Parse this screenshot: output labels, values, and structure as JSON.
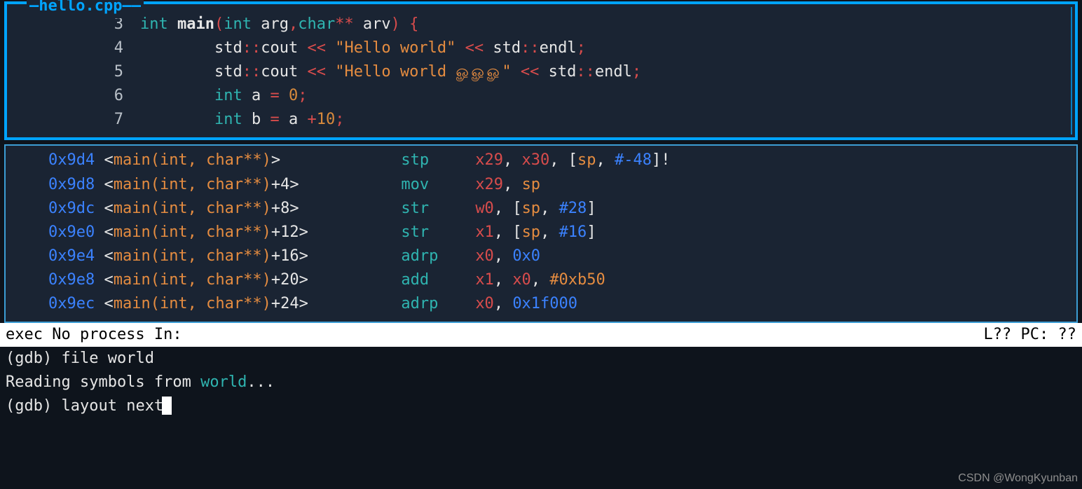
{
  "source": {
    "title_prefix": "—",
    "title": "hello.cpp",
    "title_suffix": "——",
    "lines": [
      {
        "n": "3",
        "ind": "",
        "tokens": [
          [
            "kw",
            "int "
          ],
          [
            "fn",
            "main"
          ],
          [
            "pr",
            "("
          ],
          [
            "kw",
            "int"
          ],
          [
            "id",
            " arg"
          ],
          [
            "pr",
            ","
          ],
          [
            "kw",
            "char"
          ],
          [
            "pr",
            "**"
          ],
          [
            "id",
            " arv"
          ],
          [
            "pr",
            ")"
          ],
          [
            "id",
            " "
          ],
          [
            "pr",
            "{"
          ]
        ]
      },
      {
        "n": "4",
        "ind": "        ",
        "tokens": [
          [
            "ns",
            "std"
          ],
          [
            "pr",
            "::"
          ],
          [
            "id",
            "cout"
          ],
          [
            "id",
            " "
          ],
          [
            "op",
            "<<"
          ],
          [
            "id",
            " "
          ],
          [
            "str",
            "\"Hello world\""
          ],
          [
            "id",
            " "
          ],
          [
            "op",
            "<<"
          ],
          [
            "id",
            " "
          ],
          [
            "ns",
            "std"
          ],
          [
            "pr",
            "::"
          ],
          [
            "id",
            "endl"
          ],
          [
            "pr",
            ";"
          ]
        ]
      },
      {
        "n": "5",
        "ind": "        ",
        "tokens": [
          [
            "ns",
            "std"
          ],
          [
            "pr",
            "::"
          ],
          [
            "id",
            "cout"
          ],
          [
            "id",
            " "
          ],
          [
            "op",
            "<<"
          ],
          [
            "id",
            " "
          ],
          [
            "str",
            "\"Hello world ௐௐௐ\""
          ],
          [
            "id",
            " "
          ],
          [
            "op",
            "<<"
          ],
          [
            "id",
            " "
          ],
          [
            "ns",
            "std"
          ],
          [
            "pr",
            "::"
          ],
          [
            "id",
            "endl"
          ],
          [
            "pr",
            ";"
          ]
        ]
      },
      {
        "n": "6",
        "ind": "        ",
        "tokens": [
          [
            "kw",
            "int"
          ],
          [
            "id",
            " a "
          ],
          [
            "pr",
            "="
          ],
          [
            "id",
            " "
          ],
          [
            "num",
            "0"
          ],
          [
            "pr",
            ";"
          ]
        ]
      },
      {
        "n": "7",
        "ind": "        ",
        "tokens": [
          [
            "kw",
            "int"
          ],
          [
            "id",
            " b "
          ],
          [
            "pr",
            "="
          ],
          [
            "id",
            " a "
          ],
          [
            "pr",
            "+"
          ],
          [
            "num",
            "10"
          ],
          [
            "pr",
            ";"
          ]
        ]
      }
    ]
  },
  "asm": {
    "rows": [
      {
        "addr": "0x9d4",
        "sym": "main(int, char**)",
        "off": "",
        "mn": "stp",
        "ops": [
          [
            "reg-red",
            "x29"
          ],
          [
            "comma",
            ", "
          ],
          [
            "reg-red",
            "x30"
          ],
          [
            "comma",
            ", "
          ],
          [
            "bracket",
            "["
          ],
          [
            "reg-orange",
            "sp"
          ],
          [
            "comma",
            ", "
          ],
          [
            "imm-blue",
            "#-48"
          ],
          [
            "bracket",
            "]"
          ],
          [
            "bracket",
            "!"
          ]
        ]
      },
      {
        "addr": "0x9d8",
        "sym": "main(int, char**)",
        "off": "+4",
        "mn": "mov",
        "ops": [
          [
            "reg-red",
            "x29"
          ],
          [
            "comma",
            ", "
          ],
          [
            "reg-orange",
            "sp"
          ]
        ]
      },
      {
        "addr": "0x9dc",
        "sym": "main(int, char**)",
        "off": "+8",
        "mn": "str",
        "ops": [
          [
            "reg-red",
            "w0"
          ],
          [
            "comma",
            ", "
          ],
          [
            "bracket",
            "["
          ],
          [
            "reg-orange",
            "sp"
          ],
          [
            "comma",
            ", "
          ],
          [
            "imm-blue",
            "#28"
          ],
          [
            "bracket",
            "]"
          ]
        ]
      },
      {
        "addr": "0x9e0",
        "sym": "main(int, char**)",
        "off": "+12",
        "mn": "str",
        "ops": [
          [
            "reg-red",
            "x1"
          ],
          [
            "comma",
            ", "
          ],
          [
            "bracket",
            "["
          ],
          [
            "reg-orange",
            "sp"
          ],
          [
            "comma",
            ", "
          ],
          [
            "imm-blue",
            "#16"
          ],
          [
            "bracket",
            "]"
          ]
        ]
      },
      {
        "addr": "0x9e4",
        "sym": "main(int, char**)",
        "off": "+16",
        "mn": "adrp",
        "ops": [
          [
            "reg-red",
            "x0"
          ],
          [
            "comma",
            ", "
          ],
          [
            "imm-blue",
            "0x0"
          ]
        ]
      },
      {
        "addr": "0x9e8",
        "sym": "main(int, char**)",
        "off": "+20",
        "mn": "add",
        "ops": [
          [
            "reg-red",
            "x1"
          ],
          [
            "comma",
            ", "
          ],
          [
            "reg-red",
            "x0"
          ],
          [
            "comma",
            ", "
          ],
          [
            "imm-orange",
            "#0xb50"
          ]
        ]
      },
      {
        "addr": "0x9ec",
        "sym": "main(int, char**)",
        "off": "+24",
        "mn": "adrp",
        "ops": [
          [
            "reg-red",
            "x0"
          ],
          [
            "comma",
            ", "
          ],
          [
            "imm-blue",
            "0x1f000"
          ]
        ]
      }
    ]
  },
  "status": {
    "left": "exec No process In:",
    "right": "L??   PC: ??"
  },
  "console": {
    "lines": [
      {
        "segments": [
          [
            "gdb-prompt",
            "(gdb) "
          ],
          [
            "plain",
            "file world"
          ]
        ]
      },
      {
        "segments": [
          [
            "plain",
            "Reading symbols from "
          ],
          [
            "world",
            "world"
          ],
          [
            "plain",
            "..."
          ]
        ]
      },
      {
        "segments": [
          [
            "gdb-prompt",
            "(gdb) "
          ],
          [
            "plain",
            "layout next"
          ]
        ],
        "cursor": true
      }
    ]
  },
  "watermark": "CSDN @WongKyunban"
}
